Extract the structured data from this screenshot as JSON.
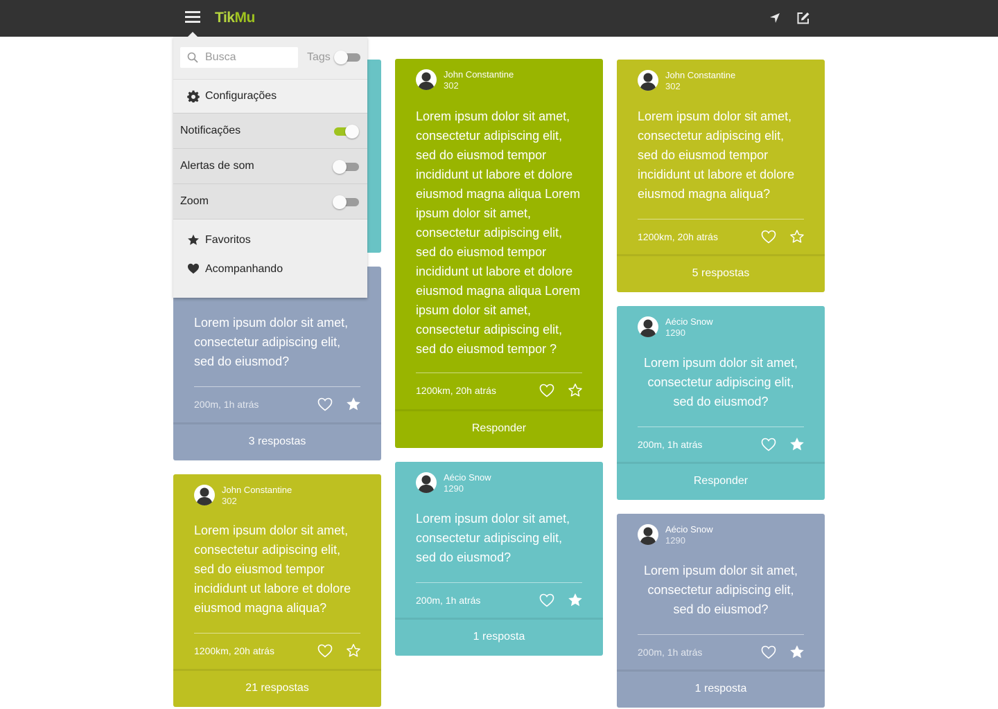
{
  "colors": {
    "topbar": "#333333",
    "accent": "#9fc31f",
    "card_gray": "#92a2bd",
    "card_teal": "#69c3c5",
    "card_lime": "#bec021",
    "card_green": "#99b500"
  },
  "header": {
    "logo_part1": "Tik",
    "logo_part2": "Mu",
    "menu_icon": "hamburger-icon",
    "location_icon": "location-arrow-icon",
    "compose_icon": "compose-icon"
  },
  "menu": {
    "search_placeholder": "Busca",
    "tags_label": "Tags",
    "tags_toggle_on": false,
    "configuracoes_label": "Configurações",
    "settings": [
      {
        "label": "Notificações",
        "on": true
      },
      {
        "label": "Alertas de som",
        "on": false
      },
      {
        "label": "Zoom",
        "on": false
      }
    ],
    "favoritos_label": "Favoritos",
    "acompanhando_label": "Acompanhando"
  },
  "cards": [
    {
      "text": "Lorem ipsum dolor sit amet, consectetur adipiscing elit, sed do eiusmod?",
      "meta": "200m, 1h atrás",
      "starred": true,
      "footer": "3 respostas"
    },
    {
      "user": "John Constantine",
      "score": "302",
      "text": "Lorem ipsum dolor sit amet, consectetur adipiscing elit, sed do eiusmod tempor incididunt ut labore et dolore eiusmod magna aliqua?",
      "meta": "1200km, 20h atrás",
      "starred": false,
      "footer": "21 respostas"
    },
    {
      "user": "John Constantine",
      "score": "302",
      "text": "Lorem ipsum dolor sit amet, consectetur adipiscing elit, sed do eiusmod tempor incididunt ut labore et dolore eiusmod magna aliqua Lorem ipsum dolor sit amet, consectetur adipiscing elit, sed do eiusmod tempor incididunt ut labore et dolore eiusmod magna aliqua Lorem ipsum dolor sit amet, consectetur adipiscing elit, sed do eiusmod tempor ?",
      "meta": "1200km, 20h atrás",
      "starred": false,
      "footer": "Responder"
    },
    {
      "user": "Aécio Snow",
      "score": "1290",
      "text": "Lorem ipsum dolor sit amet, consectetur adipiscing elit, sed do eiusmod?",
      "meta": "200m, 1h atrás",
      "starred": true,
      "footer": "1 resposta"
    },
    {
      "user": "John Constantine",
      "score": "302",
      "text": "Lorem ipsum dolor sit amet, consectetur adipiscing elit, sed do eiusmod tempor incididunt ut labore et dolore eiusmod magna aliqua?",
      "meta": "1200km, 20h atrás",
      "starred": false,
      "footer": "5 respostas"
    },
    {
      "user": "Aécio Snow",
      "score": "1290",
      "text": "Lorem ipsum dolor sit amet, consectetur adipiscing elit, sed do eiusmod?",
      "meta": "200m, 1h atrás",
      "starred": true,
      "footer": "Responder"
    },
    {
      "user": "Aécio Snow",
      "score": "1290",
      "text": "Lorem ipsum dolor sit amet, consectetur adipiscing elit, sed do eiusmod?",
      "meta": "200m, 1h atrás",
      "starred": true,
      "footer": "1 resposta"
    }
  ]
}
